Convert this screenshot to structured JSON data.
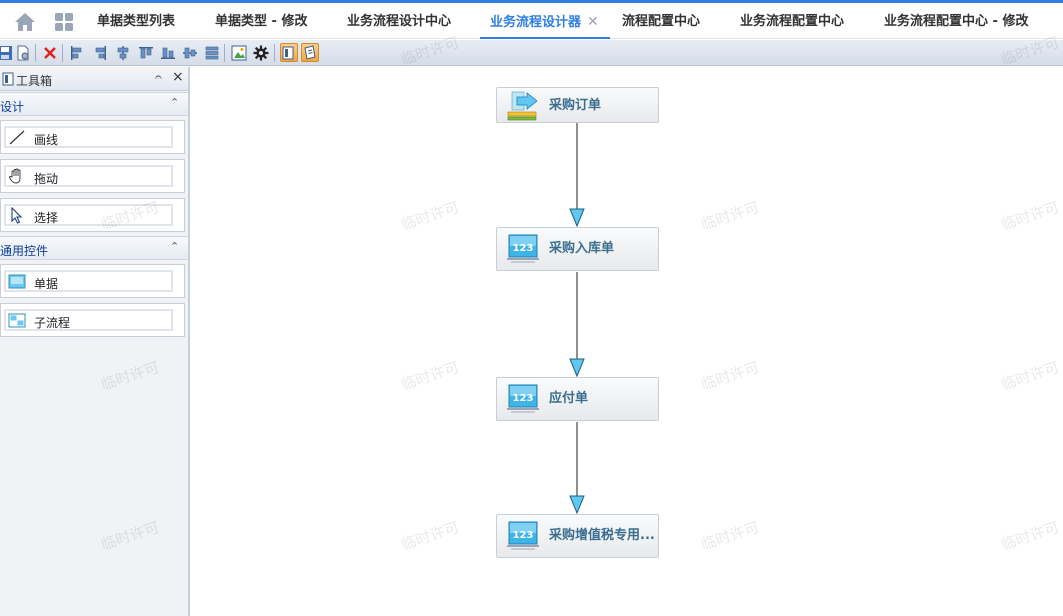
{
  "tabs": [
    {
      "label": "单据类型列表"
    },
    {
      "label": "单据类型 - 修改"
    },
    {
      "label": "业务流程设计中心"
    },
    {
      "label": "业务流程设计器",
      "close": "✕"
    },
    {
      "label": "流程配置中心"
    },
    {
      "label": "业务流程配置中心"
    },
    {
      "label": "业务流程配置中心 - 修改"
    }
  ],
  "toolbox": {
    "title": "工具箱",
    "pin": "𝄐",
    "close": "×",
    "sections": [
      {
        "title": "设计",
        "chevron": "⌃",
        "items": [
          {
            "label": "画线",
            "icon": "line-icon"
          },
          {
            "label": "拖动",
            "icon": "hand-icon"
          },
          {
            "label": "选择",
            "icon": "pointer-icon"
          }
        ]
      },
      {
        "title": "通用控件",
        "chevron": "⌃",
        "items": [
          {
            "label": "单据",
            "icon": "document-icon"
          },
          {
            "label": "子流程",
            "icon": "subflow-icon"
          }
        ]
      }
    ]
  },
  "flow": {
    "nodes": [
      {
        "label": "采购订单",
        "icon": "start-arrow-icon"
      },
      {
        "label": "采购入库单",
        "icon": "number-123-icon"
      },
      {
        "label": "应付单",
        "icon": "number-123-icon"
      },
      {
        "label": "采购增值税专用...",
        "icon": "number-123-icon"
      }
    ],
    "icon_text": "123"
  },
  "watermark": "临时许可",
  "colors": {
    "accent": "#2f7fe0",
    "node_text": "#3a6e8f",
    "arrow_fill": "#5ec8f0"
  }
}
